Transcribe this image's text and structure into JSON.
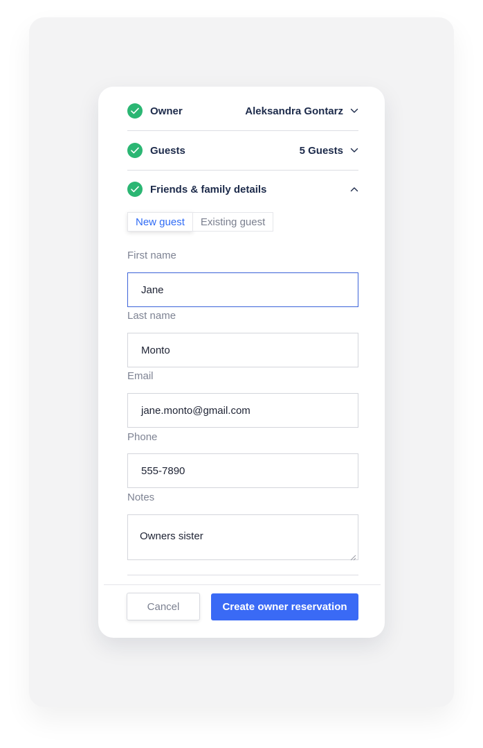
{
  "sections": {
    "owner": {
      "title": "Owner",
      "value": "Aleksandra Gontarz"
    },
    "guests": {
      "title": "Guests",
      "value": "5 Guests"
    },
    "details": {
      "title": "Friends & family details"
    }
  },
  "tabs": {
    "new_guest": "New guest",
    "existing_guest": "Existing guest"
  },
  "form": {
    "first_name": {
      "label": "First name",
      "value": "Jane"
    },
    "last_name": {
      "label": "Last name",
      "value": "Monto"
    },
    "email": {
      "label": "Email",
      "value": "jane.monto@gmail.com"
    },
    "phone": {
      "label": "Phone",
      "value": "555-7890"
    },
    "notes": {
      "label": "Notes",
      "value": "Owners sister"
    }
  },
  "buttons": {
    "cancel": "Cancel",
    "create": "Create owner reservation"
  },
  "colors": {
    "accent": "#3a6af5",
    "success": "#2bb673",
    "heading": "#1c2a4a"
  }
}
